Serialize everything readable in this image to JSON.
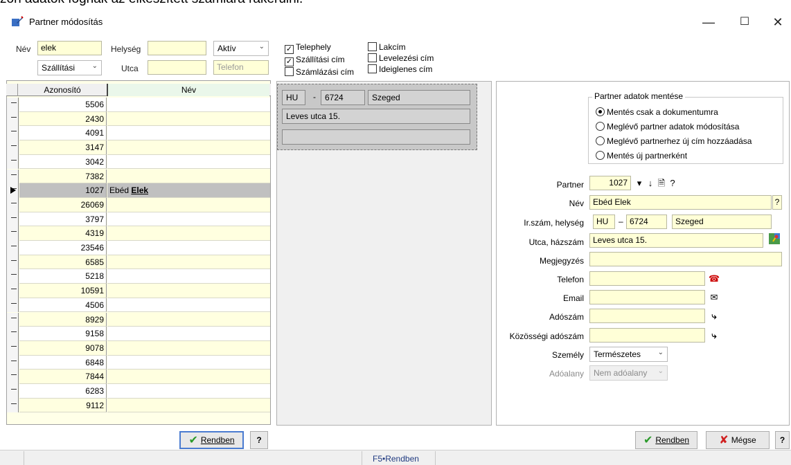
{
  "top_text": "zon adatok fognak az elkészített számlára rákerülni.",
  "window": {
    "title": "Partner módosítás",
    "minimize": "—",
    "maximize": "☐",
    "close": "✕"
  },
  "filter": {
    "nev_label": "Név",
    "nev_value": "elek",
    "helyseg_label": "Helység",
    "helyseg_value": "",
    "status_select": "Aktív",
    "cim_select": "Szállítási",
    "utca_label": "Utca",
    "utca_value": "",
    "telefon_placeholder": "Telefon",
    "checkboxes": [
      {
        "label": "Telephely",
        "checked": true
      },
      {
        "label": "Szállítási cím",
        "checked": true
      },
      {
        "label": "Számlázási cím",
        "checked": false
      },
      {
        "label": "Lakcím",
        "checked": false
      },
      {
        "label": "Levelezési cím",
        "checked": false
      },
      {
        "label": "Ideiglenes cím",
        "checked": false
      }
    ]
  },
  "grid": {
    "col_id": "Azonosító",
    "col_name": "Név",
    "rows": [
      {
        "id": "5506",
        "name": ""
      },
      {
        "id": "2430",
        "name": ""
      },
      {
        "id": "4091",
        "name": ""
      },
      {
        "id": "3147",
        "name": ""
      },
      {
        "id": "3042",
        "name": ""
      },
      {
        "id": "7382",
        "name": ""
      },
      {
        "id": "1027",
        "name": "Ebéd ",
        "name_bold": "Elek",
        "selected": true
      },
      {
        "id": "26069",
        "name": ""
      },
      {
        "id": "3797",
        "name": ""
      },
      {
        "id": "4319",
        "name": ""
      },
      {
        "id": "23546",
        "name": ""
      },
      {
        "id": "6585",
        "name": ""
      },
      {
        "id": "5218",
        "name": ""
      },
      {
        "id": "10591",
        "name": ""
      },
      {
        "id": "4506",
        "name": ""
      },
      {
        "id": "8929",
        "name": ""
      },
      {
        "id": "9158",
        "name": ""
      },
      {
        "id": "9078",
        "name": ""
      },
      {
        "id": "6848",
        "name": ""
      },
      {
        "id": "7844",
        "name": ""
      },
      {
        "id": "6283",
        "name": ""
      },
      {
        "id": "9112",
        "name": ""
      }
    ]
  },
  "address_card": {
    "country": "HU",
    "dash": "-",
    "zip": "6724",
    "city": "Szeged",
    "street": "Leves utca 15.",
    "extra": ""
  },
  "save_options": {
    "title": "Partner adatok mentése",
    "options": [
      {
        "label": "Mentés csak a dokumentumra",
        "selected": true
      },
      {
        "label": "Meglévő partner adatok módosítása",
        "selected": false
      },
      {
        "label": "Meglévő partnerhez új cím hozzáadása",
        "selected": false
      },
      {
        "label": "Mentés új partnerként",
        "selected": false
      }
    ]
  },
  "form": {
    "partner_label": "Partner",
    "partner_value": "1027",
    "nev_label": "Név",
    "nev_value": "Ebéd Elek",
    "irsz_label": "Ir.szám, helység",
    "country": "HU",
    "dash": "–",
    "zip": "6724",
    "city": "Szeged",
    "utca_label": "Utca, házszám",
    "utca_value": "Leves utca 15.",
    "megj_label": "Megjegyzés",
    "megj_value": "",
    "telefon_label": "Telefon",
    "telefon_value": "",
    "email_label": "Email",
    "email_value": "",
    "adoszam_label": "Adószám",
    "adoszam_value": "",
    "kozossegi_label": "Közösségi adószám",
    "kozossegi_value": "",
    "szemely_label": "Személy",
    "szemely_value": "Természetes",
    "adoalany_label": "Adóalany",
    "adoalany_value": "Nem adóalany"
  },
  "buttons": {
    "ok": "Rendben",
    "help": "?",
    "cancel": "Mégse",
    "ok_right": "Rendben",
    "help_right": "?"
  },
  "status": {
    "hint": "F5•Rendben"
  },
  "colors": {
    "field_bg": "#ffffd7",
    "selected_row": "#c0c0c0",
    "accent": "#4a7bd0"
  }
}
